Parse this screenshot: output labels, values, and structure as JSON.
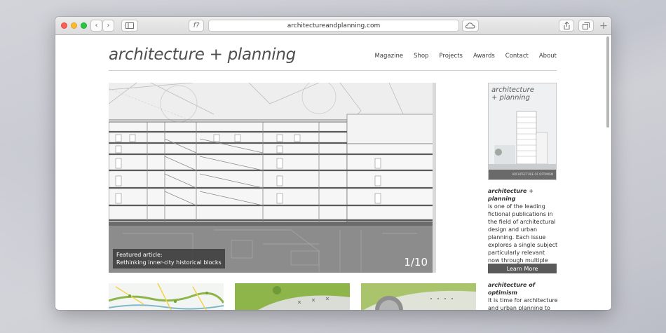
{
  "browser": {
    "url": "architectureandplanning.com",
    "reader_label": "f?"
  },
  "site": {
    "logo": "architecture + planning",
    "nav": [
      "Magazine",
      "Shop",
      "Projects",
      "Awards",
      "Contact",
      "About"
    ]
  },
  "hero": {
    "caption_line1": "Featured article:",
    "caption_line2": "Rethinking inner-city historical blocks",
    "counter": "1/10"
  },
  "sidebar": {
    "cover_title_line1": "architecture",
    "cover_title_line2": "+ planning",
    "cover_footer": "ARCHITECTURE OF OPTIMISM",
    "about_title": "architecture + planning",
    "about_body": "is one of the leading fictional publications in the field of architectural design and urban planning. Each issue explores a single subject particularly relevant now through multiple projects.",
    "learn_more": "Learn More",
    "article_title": "architecture of optimism",
    "article_body": "It is time for architecture and urban planning to once again adopt confident hope"
  },
  "colors": {
    "accent": "#5a5a5a",
    "thumb_green": "#8eb54a",
    "thumb_yellow": "#f2d34a"
  }
}
